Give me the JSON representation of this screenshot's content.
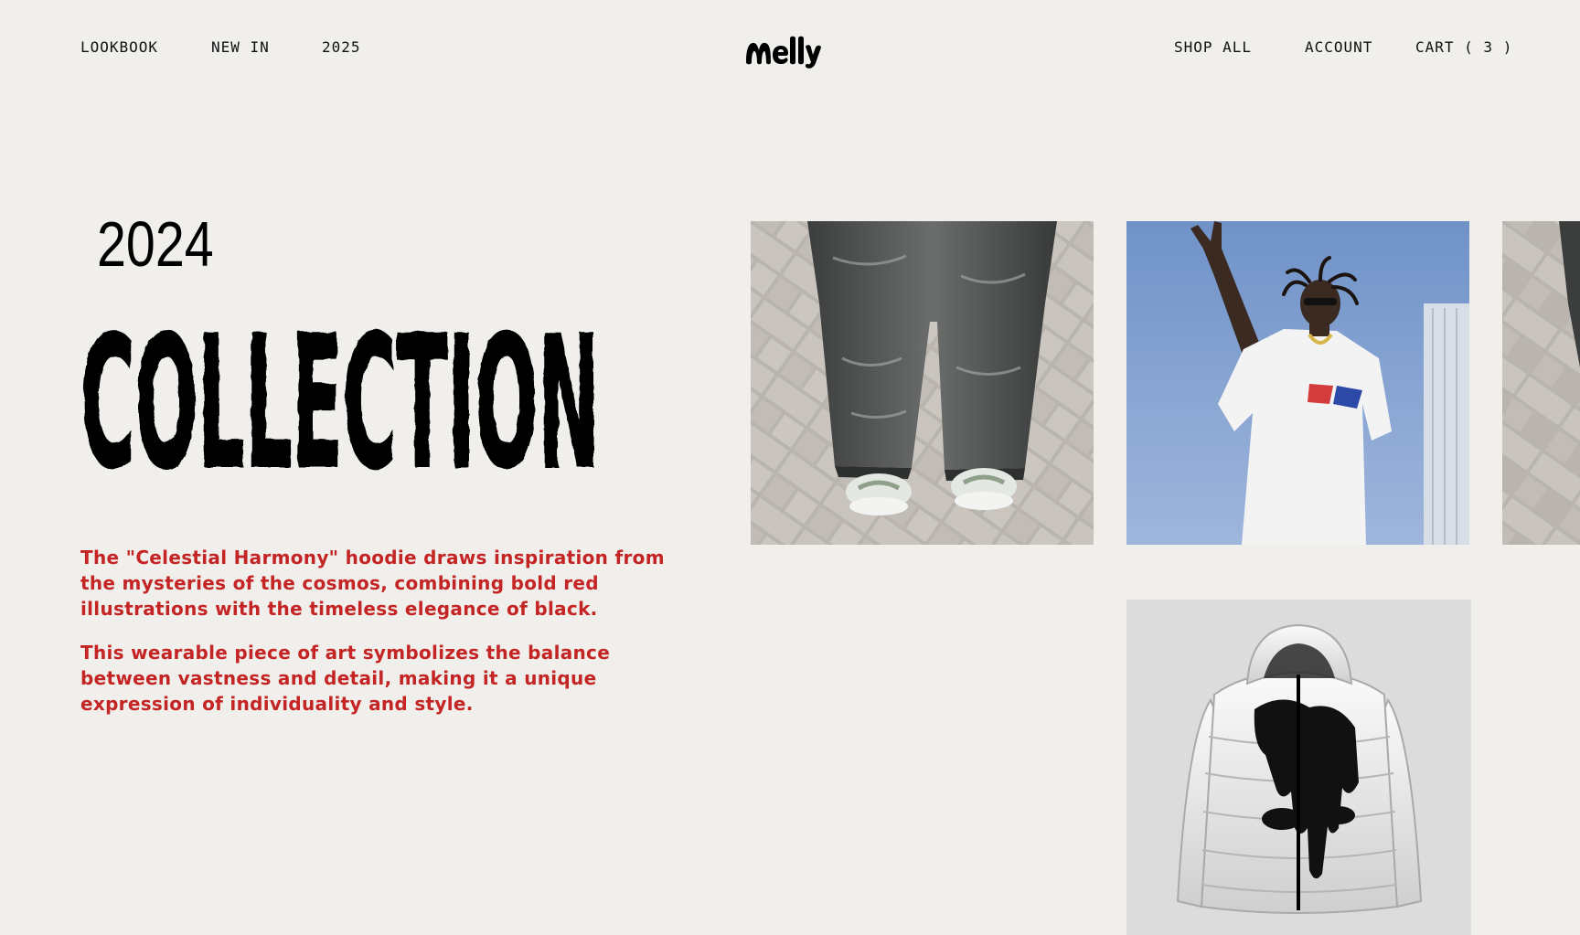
{
  "header": {
    "nav_left": [
      "LOOKBOOK",
      "NEW IN",
      "2025"
    ],
    "brand": "Melly",
    "nav_right": {
      "shop_all": "SHOP ALL",
      "account": "ACCOUNT",
      "cart": "CART ( 3 )"
    }
  },
  "hero": {
    "year": "2024",
    "title": "COLLECTION",
    "paragraphs": [
      "The \"Celestial Harmony\" hoodie draws inspiration from the mysteries of the cosmos, combining bold red illustrations with the timeless elegance of black.",
      " This wearable piece of art symbolizes the balance between vastness and detail, making it a unique expression of individuality and style."
    ]
  },
  "gallery": {
    "images": [
      {
        "name": "jeans-photo"
      },
      {
        "name": "jumping-man-photo"
      },
      {
        "name": "partial-photo"
      },
      {
        "name": "puffer-jacket-photo"
      }
    ]
  },
  "colors": {
    "background": "#f0efeb",
    "accent": "#c42424",
    "text": "#111111"
  }
}
